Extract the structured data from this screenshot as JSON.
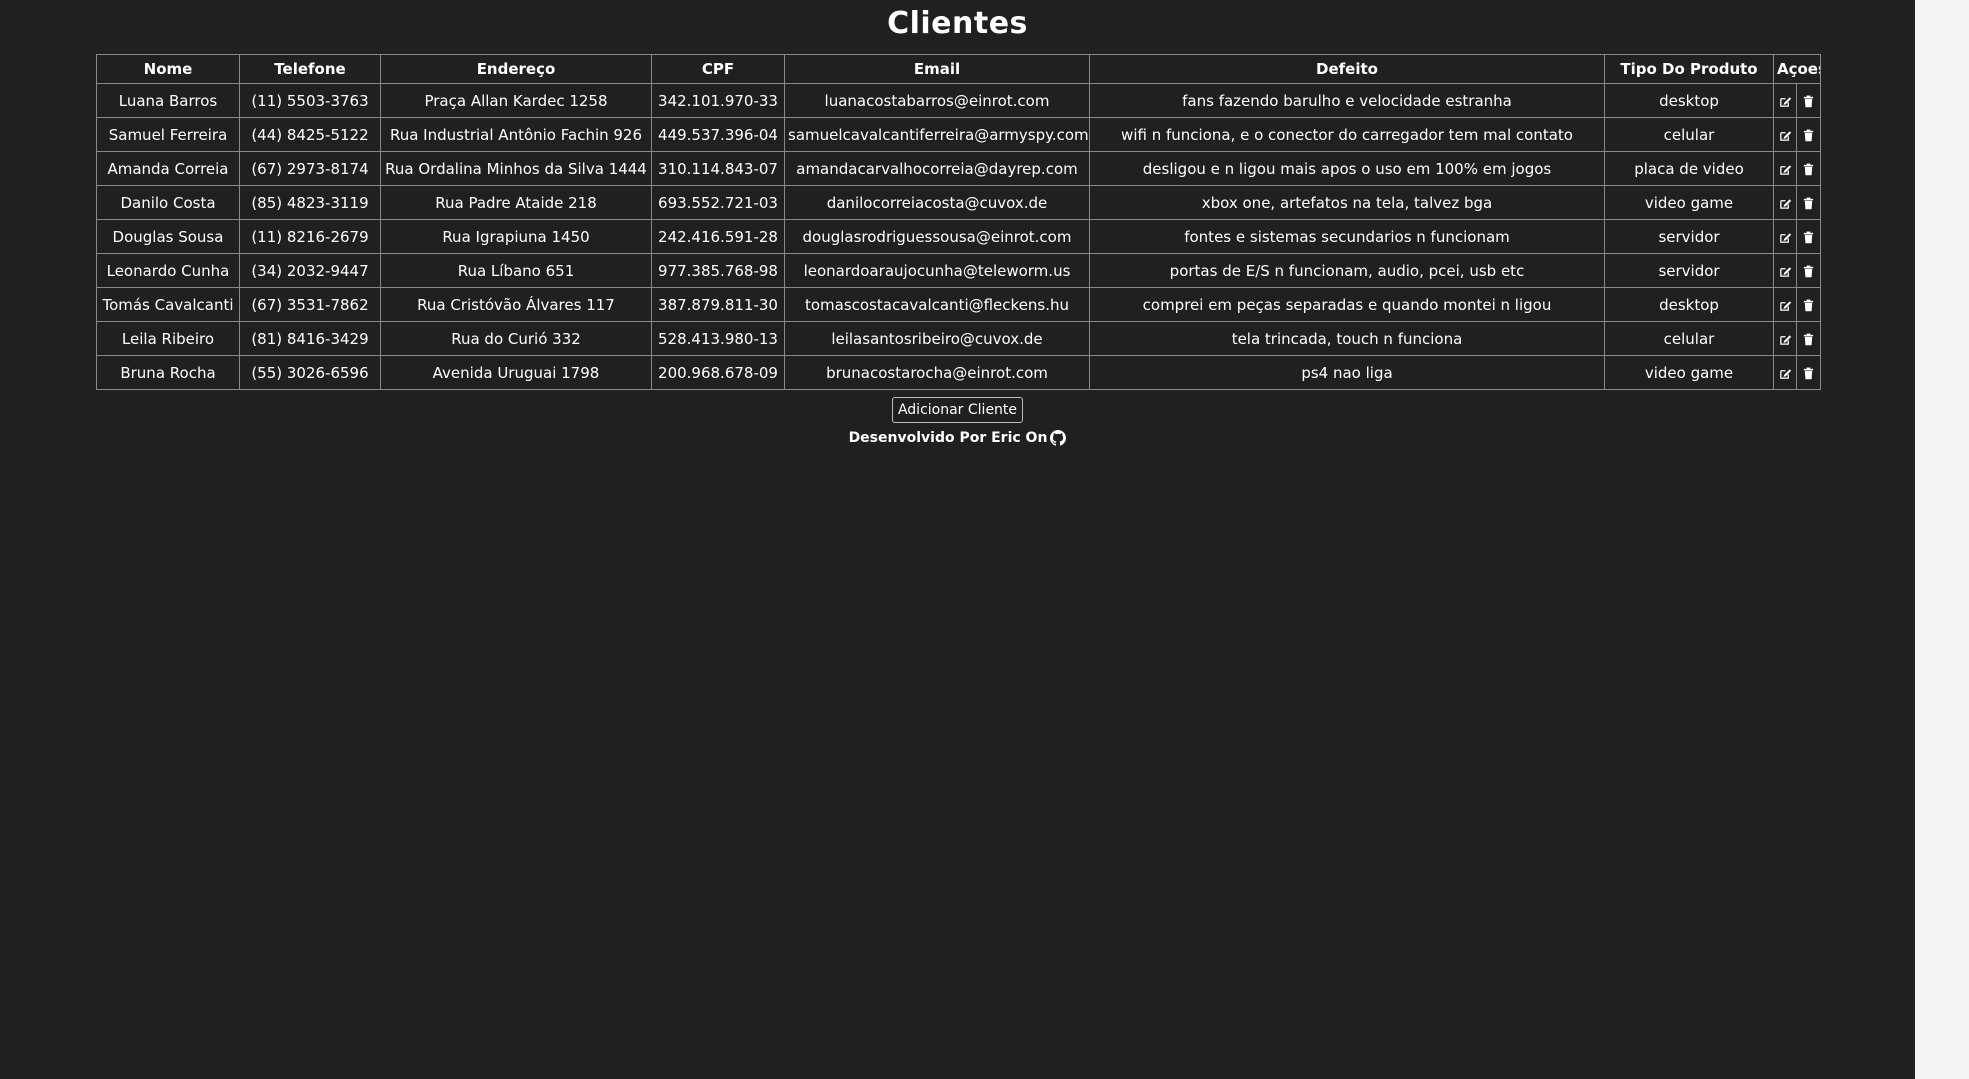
{
  "page": {
    "title": "Clientes",
    "add_button_label": "Adicionar Cliente",
    "credit_text": "Desenvolvido Por Eric On",
    "credit_icon": "github-icon"
  },
  "table": {
    "headers": [
      "Nome",
      "Telefone",
      "Endereço",
      "CPF",
      "Email",
      "Defeito",
      "Tipo Do Produto",
      "Açoes"
    ],
    "action_icons": [
      "edit-icon",
      "trash-icon"
    ],
    "rows": [
      {
        "nome": "Luana Barros",
        "telefone": "(11) 5503-3763",
        "endereco": "Praça Allan Kardec 1258",
        "cpf": "342.101.970-33",
        "email": "luanacostabarros@einrot.com",
        "defeito": "fans fazendo barulho e velocidade estranha",
        "tipo": "desktop"
      },
      {
        "nome": "Samuel Ferreira",
        "telefone": "(44) 8425-5122",
        "endereco": "Rua Industrial Antônio Fachin 926",
        "cpf": "449.537.396-04",
        "email": "samuelcavalcantiferreira@armyspy.com",
        "defeito": "wifi n funciona, e o conector do carregador tem mal contato",
        "tipo": "celular"
      },
      {
        "nome": "Amanda Correia",
        "telefone": "(67) 2973-8174",
        "endereco": "Rua Ordalina Minhos da Silva 1444",
        "cpf": "310.114.843-07",
        "email": "amandacarvalhocorreia@dayrep.com",
        "defeito": "desligou e n ligou mais apos o uso em 100% em jogos",
        "tipo": "placa de video"
      },
      {
        "nome": "Danilo Costa",
        "telefone": "(85) 4823-3119",
        "endereco": "Rua Padre Ataide 218",
        "cpf": "693.552.721-03",
        "email": "danilocorreiacosta@cuvox.de",
        "defeito": "xbox one, artefatos na tela, talvez bga",
        "tipo": "video game"
      },
      {
        "nome": "Douglas Sousa",
        "telefone": "(11) 8216-2679",
        "endereco": "Rua Igrapiuna 1450",
        "cpf": "242.416.591-28",
        "email": "douglasrodriguessousa@einrot.com",
        "defeito": "fontes e sistemas secundarios n funcionam",
        "tipo": "servidor"
      },
      {
        "nome": "Leonardo Cunha",
        "telefone": "(34) 2032-9447",
        "endereco": "Rua Líbano 651",
        "cpf": "977.385.768-98",
        "email": "leonardoaraujocunha@teleworm.us",
        "defeito": "portas de E/S n funcionam, audio, pcei, usb etc",
        "tipo": "servidor"
      },
      {
        "nome": "Tomás Cavalcanti",
        "telefone": "(67) 3531-7862",
        "endereco": "Rua Cristóvão Álvares 117",
        "cpf": "387.879.811-30",
        "email": "tomascostacavalcanti@fleckens.hu",
        "defeito": "comprei em peças separadas e quando montei n ligou",
        "tipo": "desktop"
      },
      {
        "nome": "Leila Ribeiro",
        "telefone": "(81) 8416-3429",
        "endereco": "Rua do Curió 332",
        "cpf": "528.413.980-13",
        "email": "leilasantosribeiro@cuvox.de",
        "defeito": "tela trincada, touch n funciona",
        "tipo": "celular"
      },
      {
        "nome": "Bruna Rocha",
        "telefone": "(55) 3026-6596",
        "endereco": "Avenida Uruguai 1798",
        "cpf": "200.968.678-09",
        "email": "brunacostarocha@einrot.com",
        "defeito": "ps4 nao liga",
        "tipo": "video game"
      }
    ]
  }
}
